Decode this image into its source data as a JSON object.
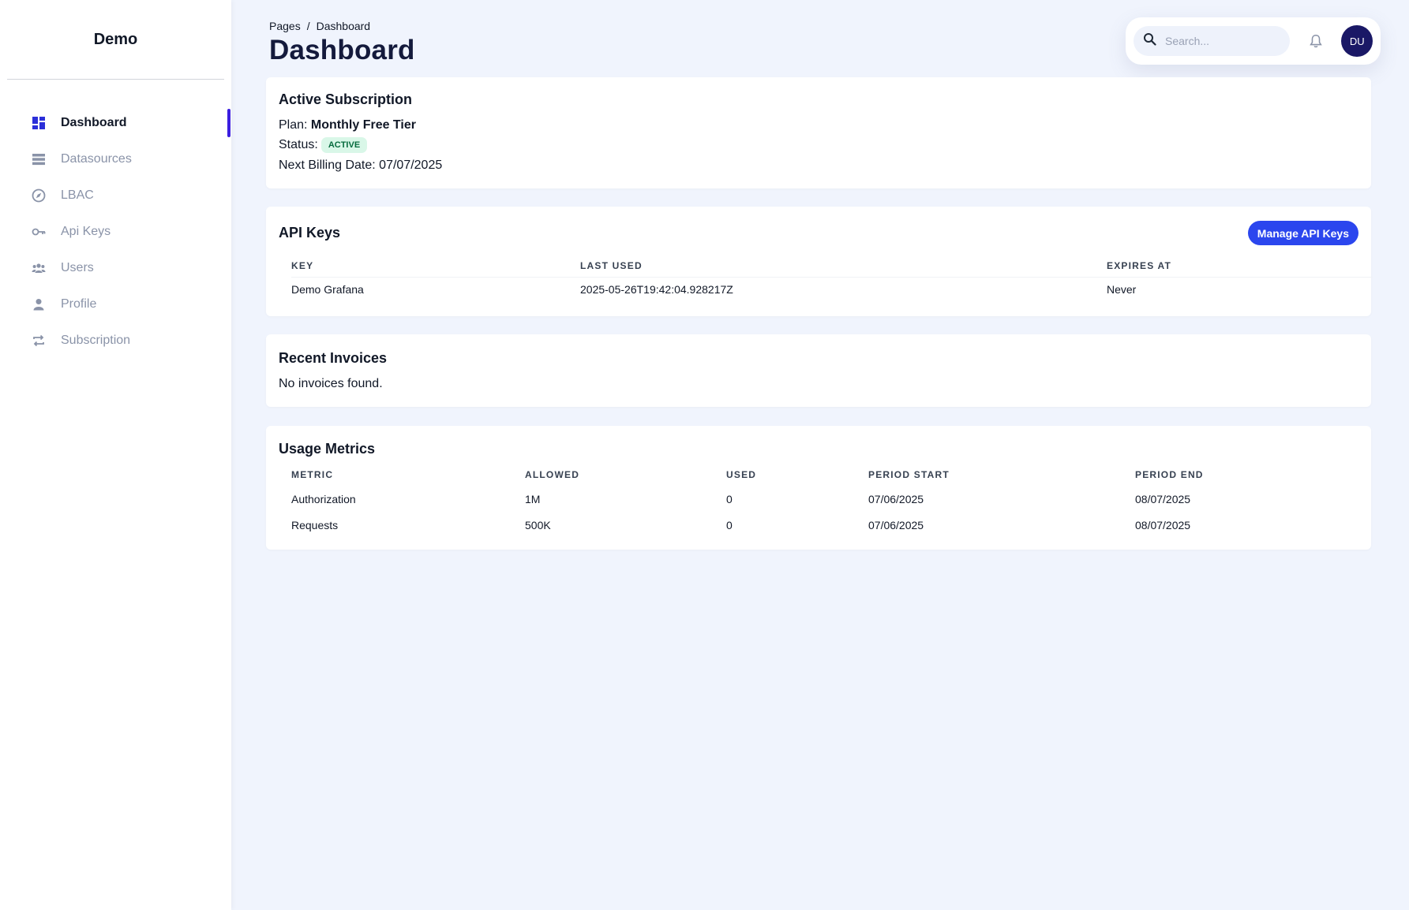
{
  "sidebar": {
    "brand": "Demo",
    "items": [
      {
        "label": "Dashboard",
        "icon": "dashboard-icon",
        "active": true
      },
      {
        "label": "Datasources",
        "icon": "list-icon",
        "active": false
      },
      {
        "label": "LBAC",
        "icon": "compass-icon",
        "active": false
      },
      {
        "label": "Api Keys",
        "icon": "key-icon",
        "active": false
      },
      {
        "label": "Users",
        "icon": "users-icon",
        "active": false
      },
      {
        "label": "Profile",
        "icon": "person-icon",
        "active": false
      },
      {
        "label": "Subscription",
        "icon": "repeat-icon",
        "active": false
      }
    ]
  },
  "header": {
    "breadcrumb_root": "Pages",
    "breadcrumb_sep": "/",
    "breadcrumb_current": "Dashboard",
    "title": "Dashboard",
    "search_placeholder": "Search...",
    "avatar_initials": "DU"
  },
  "subscription": {
    "title": "Active Subscription",
    "plan_label": "Plan:",
    "plan_value": "Monthly Free Tier",
    "status_label": "Status:",
    "status_value": "ACTIVE",
    "billing_label": "Next Billing Date:",
    "billing_value": "07/07/2025"
  },
  "api_keys": {
    "title": "API Keys",
    "manage_label": "Manage API Keys",
    "columns": [
      "KEY",
      "LAST USED",
      "EXPIRES AT"
    ],
    "rows": [
      [
        "Demo Grafana",
        "2025-05-26T19:42:04.928217Z",
        "Never"
      ]
    ]
  },
  "invoices": {
    "title": "Recent Invoices",
    "empty": "No invoices found."
  },
  "usage": {
    "title": "Usage Metrics",
    "columns": [
      "METRIC",
      "ALLOWED",
      "USED",
      "PERIOD START",
      "PERIOD END"
    ],
    "rows": [
      [
        "Authorization",
        "1M",
        "0",
        "07/06/2025",
        "08/07/2025"
      ],
      [
        "Requests",
        "500K",
        "0",
        "07/06/2025",
        "08/07/2025"
      ]
    ]
  },
  "colors": {
    "accent": "#2b46ee",
    "active_indicator": "#3b1fe0",
    "badge_bg": "#d9f7e8",
    "badge_text": "#066b3e",
    "avatar_bg": "#1a1866"
  }
}
